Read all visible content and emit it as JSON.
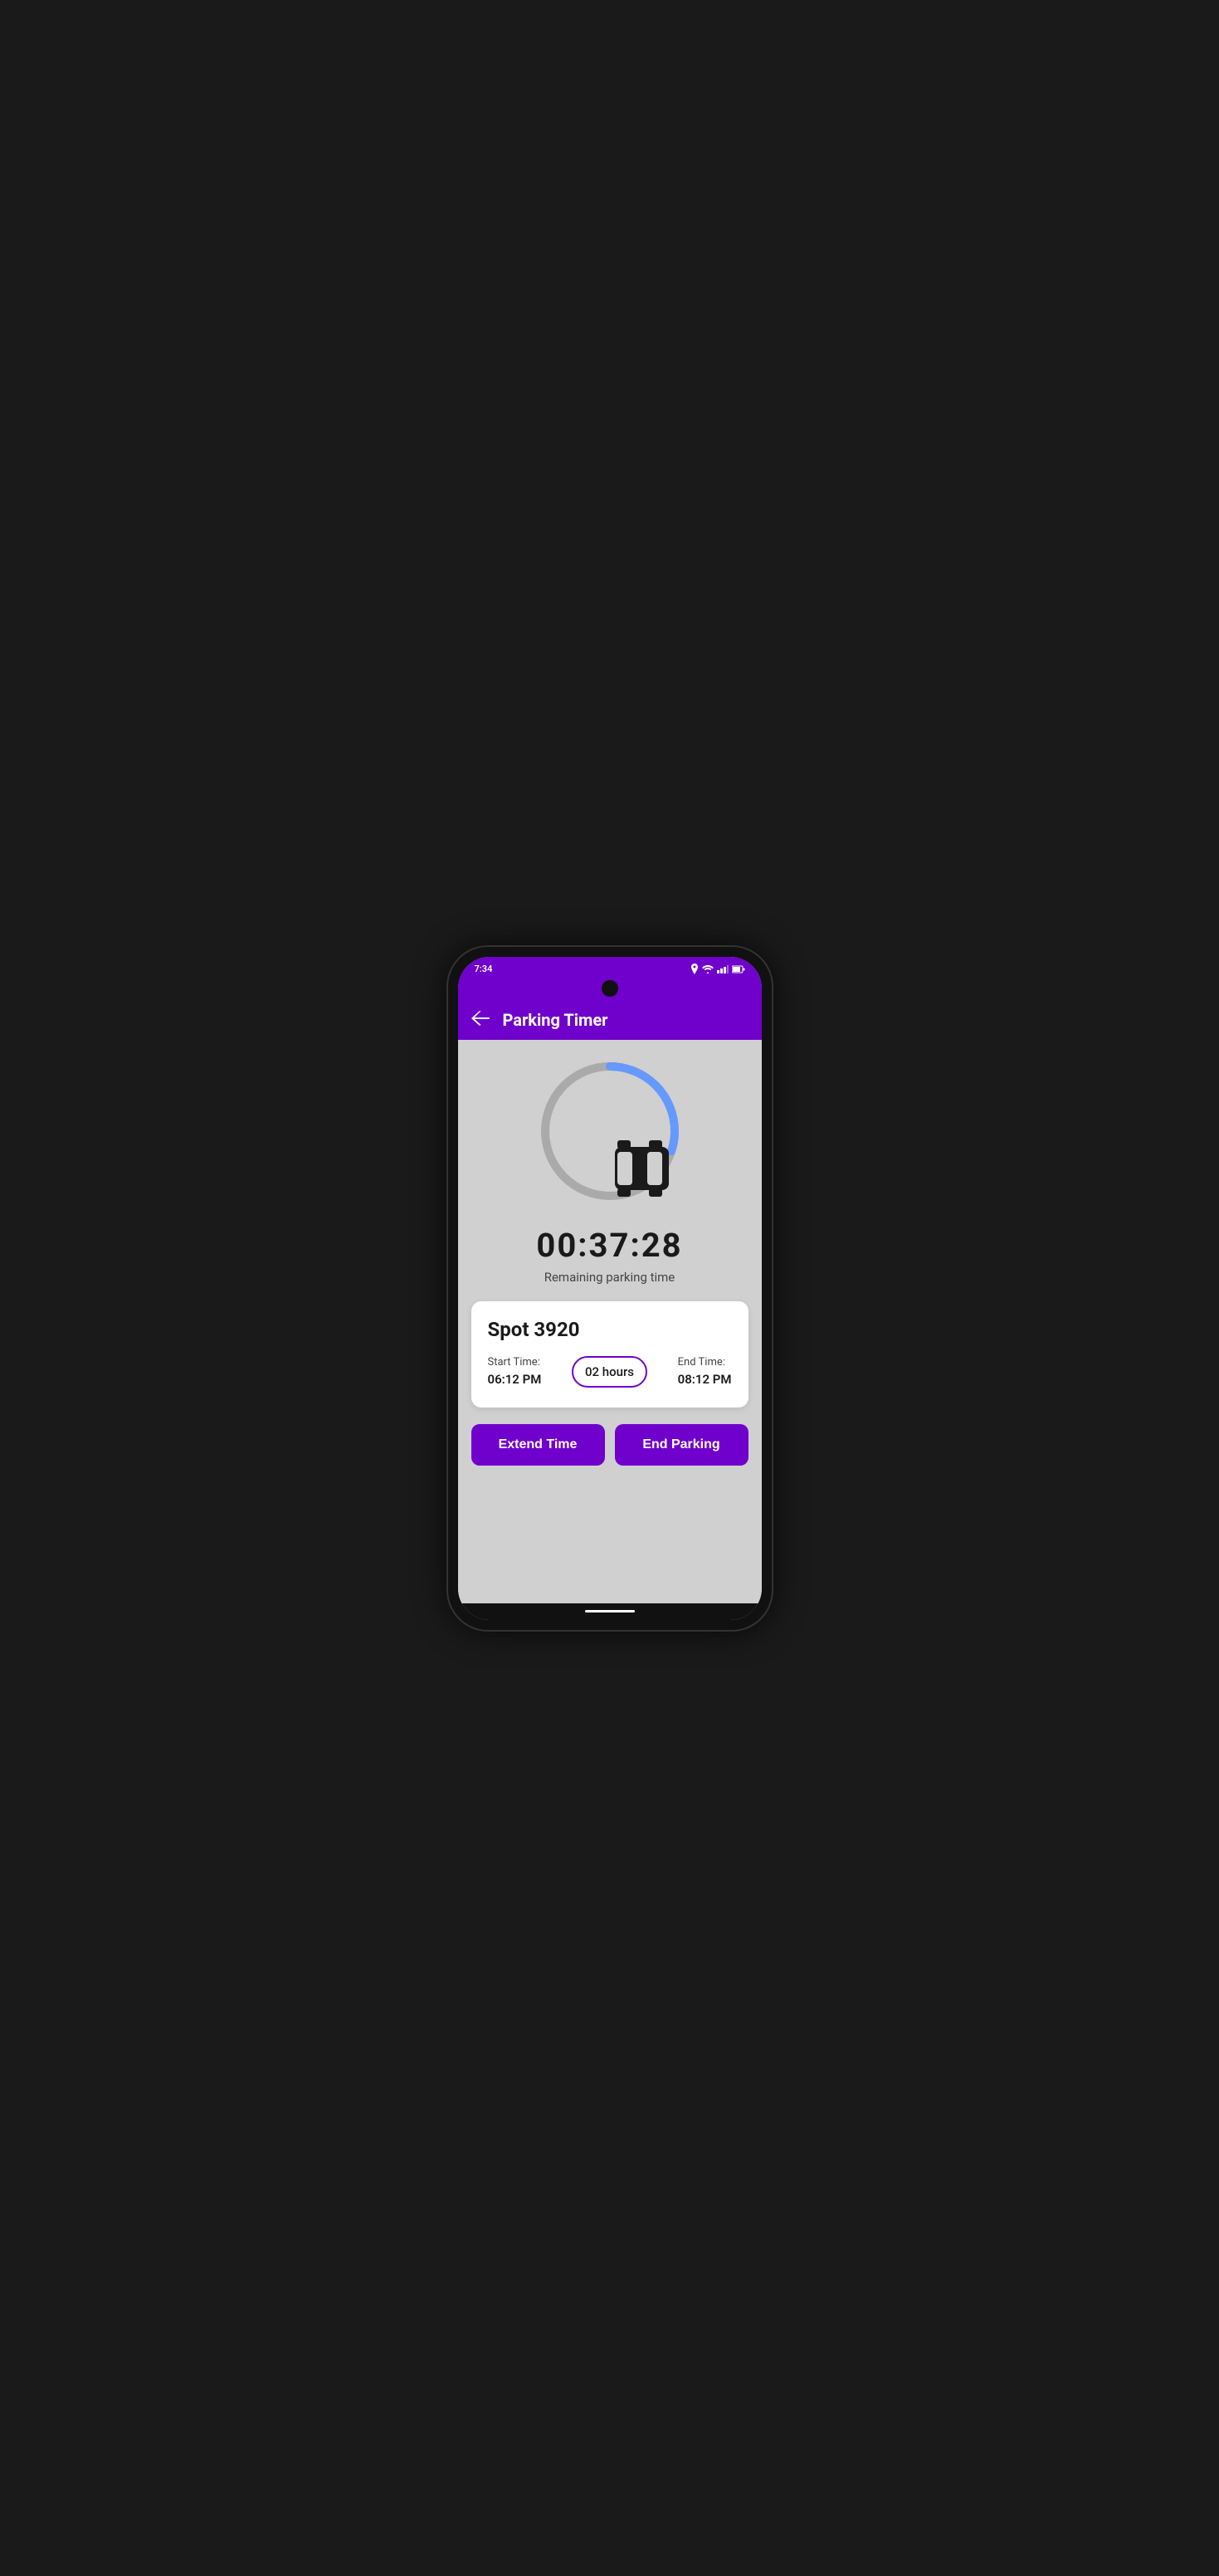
{
  "statusBar": {
    "time": "7:34"
  },
  "appBar": {
    "title": "Parking Timer",
    "backLabel": "←"
  },
  "timer": {
    "display": "00:37:28",
    "label": "Remaining parking time",
    "progressPercent": 30
  },
  "infoCard": {
    "spotNumber": "Spot 3920",
    "startTimeLabel": "Start Time:",
    "startTimeValue": "06:12 PM",
    "duration": "02 hours",
    "endTimeLabel": "End Time:",
    "endTimeValue": "08:12 PM"
  },
  "buttons": {
    "extend": "Extend Time",
    "end": "End Parking"
  },
  "colors": {
    "accent": "#7000cc",
    "progressTrack": "#aaaaaa",
    "progressFill": "#6666ff"
  }
}
